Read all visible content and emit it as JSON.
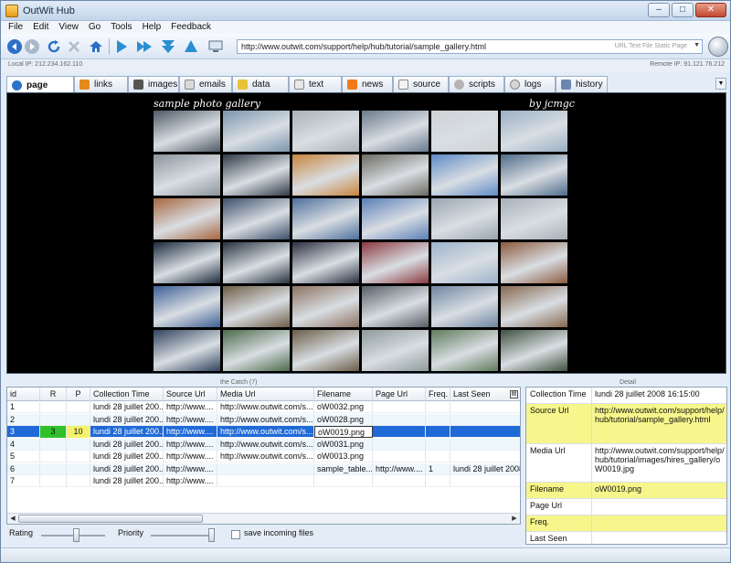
{
  "window": {
    "title": "OutWit Hub"
  },
  "menu": [
    "File",
    "Edit",
    "View",
    "Go",
    "Tools",
    "Help",
    "Feedback"
  ],
  "toolbar": {
    "url": "http://www.outwit.com/support/help/hub/tutorial/sample_gallery.html",
    "url_types": "URL Text File Static Page"
  },
  "ip": {
    "local": "Local IP: 212.234.162.110",
    "remote": "Remote IP: 91.121.76.212"
  },
  "tabs": [
    {
      "label": "page",
      "icon": "globe-icon",
      "color": "#2a74c9"
    },
    {
      "label": "links",
      "icon": "link-icon",
      "color": "#e48a1b"
    },
    {
      "label": "images",
      "icon": "image-icon",
      "color": "#555555"
    },
    {
      "label": "emails",
      "icon": "mail-icon",
      "color": "#d9d9d9"
    },
    {
      "label": "data",
      "icon": "table-icon",
      "color": "#e9c237"
    },
    {
      "label": "text",
      "icon": "page-icon",
      "color": "#e8e8e8"
    },
    {
      "label": "news",
      "icon": "rss-icon",
      "color": "#f07a1a"
    },
    {
      "label": "source",
      "icon": "code-icon",
      "color": "#f3f3f3"
    },
    {
      "label": "scripts",
      "icon": "gear-icon",
      "color": "#b5b5b5"
    },
    {
      "label": "logs",
      "icon": "clock-icon",
      "color": "#d5d5d5"
    },
    {
      "label": "history",
      "icon": "list-icon",
      "color": "#6a87b0"
    }
  ],
  "viewer": {
    "gallery_title": "sample photo gallery",
    "gallery_author": "by jcmgc"
  },
  "thumb_colors": [
    "#4f5a66",
    "#7b95ad",
    "#a9b2b7",
    "#6a7a8c",
    "#cfd3d6",
    "#9ab0c4",
    "#8c949c",
    "#2f3a46",
    "#c9853c",
    "#6d6b63",
    "#5f8bc7",
    "#4d6b8a",
    "#a6653e",
    "#3c4e6a",
    "#4d6f9b",
    "#5a7fb7",
    "#9aa5af",
    "#a8b0b8",
    "#1c2a3c",
    "#28333f",
    "#2b2f3f",
    "#8b3a40",
    "#9db3cb",
    "#8c5a3e",
    "#3e5f95",
    "#6f5c45",
    "#8d7361",
    "#585e66",
    "#6f86a1",
    "#86684f",
    "#30425c",
    "#4b6a4a",
    "#6a5d47",
    "#8e9a9c",
    "#5f7a5a",
    "#3f513f"
  ],
  "catch": {
    "label": "the Catch (7)",
    "columns": [
      "id",
      "R",
      "P",
      "Collection Time",
      "Source Url",
      "Media Url",
      "Filename",
      "Page Url",
      "Freq.",
      "Last Seen"
    ],
    "rows": [
      [
        "1",
        "",
        "",
        "lundi 28 juillet 200...",
        "http://www....",
        "http://www.outwit.com/s...",
        "oW0032.png",
        "",
        "",
        ""
      ],
      [
        "2",
        "",
        "",
        "lundi 28 juillet 200...",
        "http://www....",
        "http://www.outwit.com/s...",
        "oW0028.png",
        "",
        "",
        ""
      ],
      [
        "3",
        "3",
        "10",
        "lundi 28 juillet 200...",
        "http://www....",
        "http://www.outwit.com/s...",
        "oW0019.png",
        "",
        "",
        ""
      ],
      [
        "4",
        "",
        "",
        "lundi 28 juillet 200...",
        "http://www....",
        "http://www.outwit.com/s...",
        "oW0031.png",
        "",
        "",
        ""
      ],
      [
        "5",
        "",
        "",
        "lundi 28 juillet 200...",
        "http://www....",
        "http://www.outwit.com/s...",
        "oW0013.png",
        "",
        "",
        ""
      ],
      [
        "6",
        "",
        "",
        "lundi 28 juillet 200...",
        "http://www....",
        "",
        "sample_table....",
        "http://www....",
        "1",
        "lundi 28 juillet 2008"
      ],
      [
        "7",
        "",
        "",
        "lundi 28 juillet 200...",
        "http://www....",
        "",
        "",
        "",
        "",
        ""
      ]
    ],
    "selected_index": 2
  },
  "controls": {
    "rating_label": "Rating",
    "priority_label": "Priority",
    "save_label": "save incoming files",
    "rating_value": 0.55,
    "priority_value": 1.0
  },
  "detail": {
    "label": "Detail",
    "fields": [
      {
        "key": "Collection Time",
        "value": "lundi 28 juillet 2008 16:15:00",
        "highlight": false
      },
      {
        "key": "Source Url",
        "value": "http://www.outwit.com/support/help/hub/tutorial/sample_gallery.html",
        "highlight": true
      },
      {
        "key": "Media Url",
        "value": "http://www.outwit.com/support/help/hub/tutorial/images/hires_gallery/oW0019.jpg",
        "highlight": false
      },
      {
        "key": "Filename",
        "value": "oW0019.png",
        "highlight": true
      },
      {
        "key": "Page Url",
        "value": "",
        "highlight": false
      },
      {
        "key": "Freq.",
        "value": "",
        "highlight": true
      },
      {
        "key": "Last Seen",
        "value": "",
        "highlight": false
      }
    ]
  }
}
